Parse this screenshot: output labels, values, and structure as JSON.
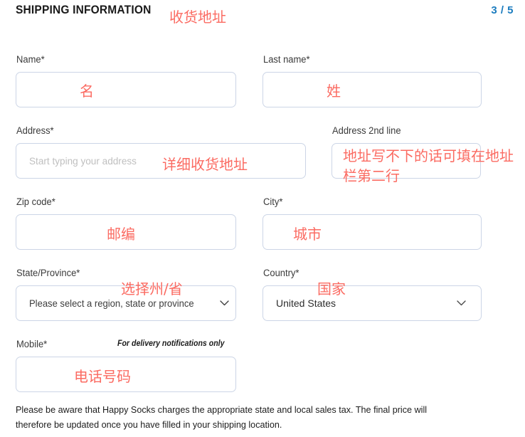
{
  "header": {
    "title": "SHIPPING INFORMATION",
    "title_annotation": "收货地址",
    "step": "3 / 5",
    "accent_color": "#1b7cbf"
  },
  "form": {
    "border_color": "#ccd5e6",
    "annotation_color": "#fb6b62",
    "placeholder_color": "#bfbfbf",
    "fields": [
      {
        "name": "first-name",
        "label": "Name*",
        "value": "",
        "placeholder": "",
        "annotation": "名"
      },
      {
        "name": "last-name",
        "label": "Last name*",
        "value": "",
        "placeholder": "",
        "annotation": "姓"
      },
      {
        "name": "address",
        "label": "Address*",
        "value": "",
        "placeholder": "Start typing your address",
        "annotation": "详细收货地址"
      },
      {
        "name": "address-2nd-line",
        "label": "Address 2nd line",
        "value": "",
        "placeholder": "",
        "annotation_line1": "地址写不下的话可填在地址",
        "annotation_line2": "栏第二行"
      },
      {
        "name": "zip-code",
        "label": "Zip code*",
        "value": "",
        "placeholder": "",
        "annotation": "邮编"
      },
      {
        "name": "city",
        "label": "City*",
        "value": "",
        "placeholder": "",
        "annotation": "城市"
      },
      {
        "name": "state-province",
        "label": "State/Province*",
        "value": "",
        "placeholder": "Please select a region, state or province",
        "annotation": "选择州/省"
      },
      {
        "name": "country",
        "label": "Country*",
        "value": "United States",
        "placeholder": "",
        "annotation": "国家"
      },
      {
        "name": "mobile",
        "label": "Mobile*",
        "hint": "For delivery notifications only",
        "value": "",
        "placeholder": "",
        "annotation": "电话号码"
      }
    ]
  },
  "footer": {
    "note": "Please be aware that Happy Socks charges the appropriate state and local sales tax. The final price will therefore be updated once you have filled in your shipping location."
  }
}
